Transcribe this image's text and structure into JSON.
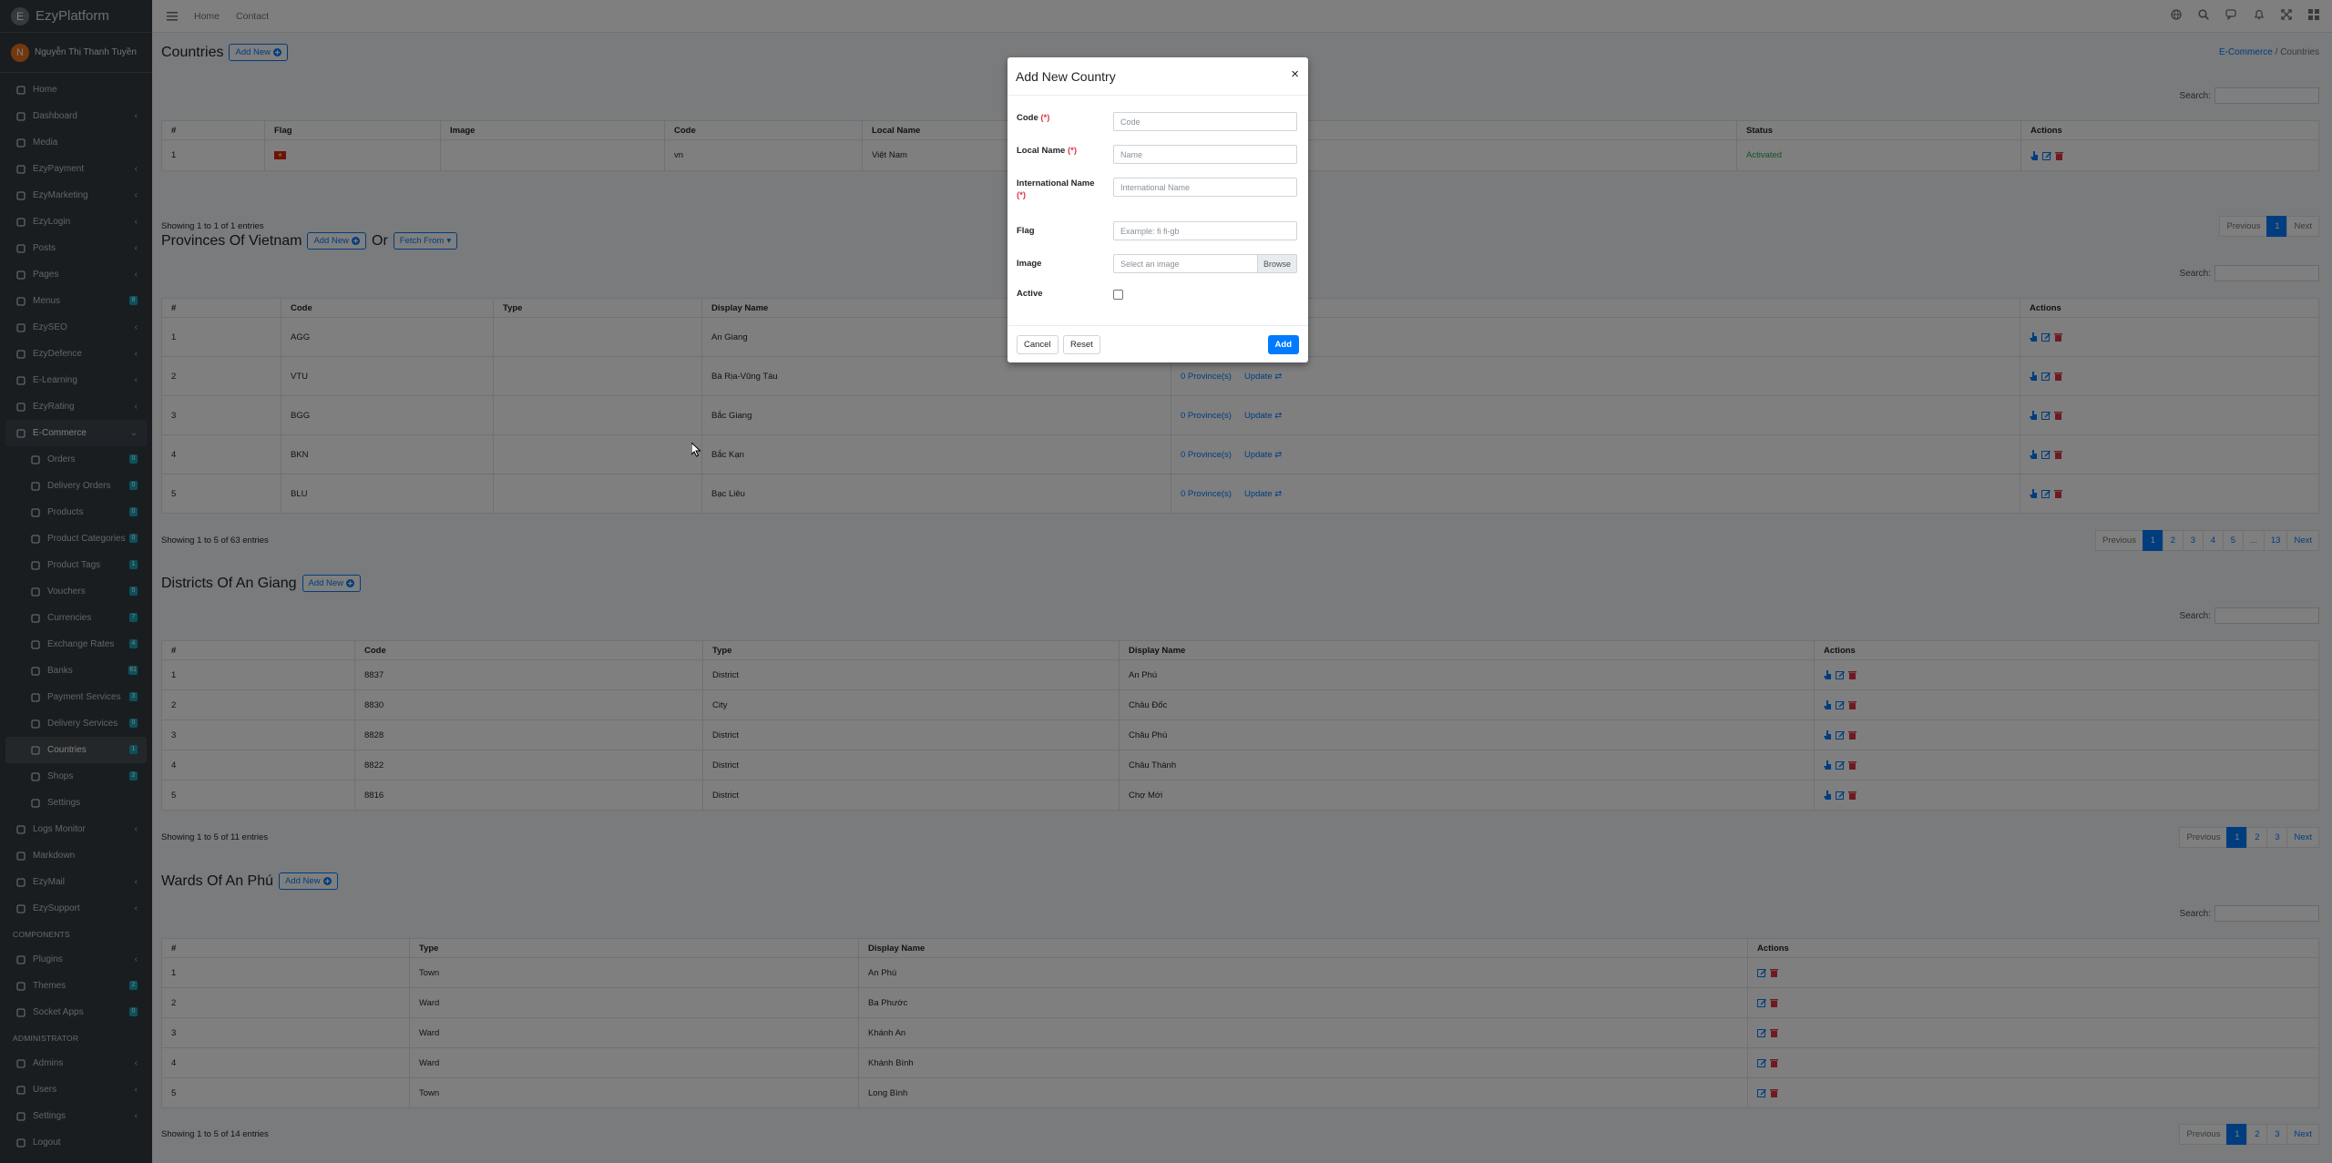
{
  "app": {
    "brand": "EzyPlatform",
    "user_name": "Nguyễn Thị Thanh Tuyền",
    "user_initial": "N"
  },
  "topbar": {
    "links": [
      "Home",
      "Contact"
    ],
    "icons": [
      "globe-icon",
      "search-icon",
      "comments-icon",
      "bell-icon",
      "expand-icon",
      "apps-grid-icon"
    ]
  },
  "sidebar": {
    "items": [
      {
        "label": "Home",
        "icon": "home-icon"
      },
      {
        "label": "Dashboard",
        "icon": "dashboard-icon",
        "arrow": true
      },
      {
        "label": "Media",
        "icon": "media-icon"
      },
      {
        "label": "EzyPayment",
        "icon": "payment-icon",
        "arrow": true
      },
      {
        "label": "EzyMarketing",
        "icon": "bullhorn-icon",
        "arrow": true
      },
      {
        "label": "EzyLogin",
        "icon": "login-icon",
        "arrow": true
      },
      {
        "label": "Posts",
        "icon": "posts-icon",
        "arrow": true
      },
      {
        "label": "Pages",
        "icon": "pages-icon",
        "arrow": true
      },
      {
        "label": "Menus",
        "icon": "menus-icon",
        "badge": "8"
      },
      {
        "label": "EzySEO",
        "icon": "seo-icon",
        "arrow": true
      },
      {
        "label": "EzyDefence",
        "icon": "shield-icon",
        "arrow": true
      },
      {
        "label": "E-Learning",
        "icon": "learning-icon",
        "arrow": true
      },
      {
        "label": "EzyRating",
        "icon": "star-icon",
        "arrow": true
      },
      {
        "label": "E-Commerce",
        "icon": "shop-icon",
        "open": true
      },
      {
        "label": "Orders",
        "icon": "orders-icon",
        "badge": "0",
        "sub": true
      },
      {
        "label": "Delivery Orders",
        "icon": "delivery-icon",
        "badge": "0",
        "sub": true
      },
      {
        "label": "Products",
        "icon": "products-icon",
        "badge": "0",
        "sub": true
      },
      {
        "label": "Product Categories",
        "icon": "categories-icon",
        "badge": "0",
        "sub": true
      },
      {
        "label": "Product Tags",
        "icon": "tags-icon",
        "badge": "1",
        "sub": true
      },
      {
        "label": "Vouchers",
        "icon": "voucher-icon",
        "badge": "0",
        "sub": true
      },
      {
        "label": "Currencies",
        "icon": "currency-icon",
        "badge": "7",
        "sub": true
      },
      {
        "label": "Exchange Rates",
        "icon": "exchange-icon",
        "badge": "4",
        "sub": true
      },
      {
        "label": "Banks",
        "icon": "bank-icon",
        "badge": "61",
        "sub": true
      },
      {
        "label": "Payment Services",
        "icon": "payment-services-icon",
        "badge": "3",
        "sub": true
      },
      {
        "label": "Delivery Services",
        "icon": "truck-icon",
        "badge": "0",
        "sub": true
      },
      {
        "label": "Countries",
        "icon": "globe-icon",
        "badge": "1",
        "sub": true,
        "active": true
      },
      {
        "label": "Shops",
        "icon": "store-icon",
        "badge": "2",
        "sub": true
      },
      {
        "label": "Settings",
        "icon": "tools-icon",
        "sub": true
      },
      {
        "label": "Logs Monitor",
        "icon": "monitor-icon",
        "arrow": true
      },
      {
        "label": "Markdown",
        "icon": "markdown-icon"
      },
      {
        "label": "EzyMail",
        "icon": "mail-icon",
        "arrow": true
      },
      {
        "label": "EzySupport",
        "icon": "support-icon",
        "arrow": true
      }
    ],
    "components_header": "COMPONENTS",
    "components": [
      {
        "label": "Plugins",
        "icon": "plug-icon",
        "arrow": true
      },
      {
        "label": "Themes",
        "icon": "brush-icon",
        "badge": "2"
      },
      {
        "label": "Socket Apps",
        "icon": "socket-icon",
        "badge": "0"
      }
    ],
    "admin_header": "ADMINISTRATOR",
    "admin": [
      {
        "label": "Admins",
        "icon": "user-icon",
        "arrow": true
      },
      {
        "label": "Users",
        "icon": "users-icon",
        "arrow": true
      },
      {
        "label": "Settings",
        "icon": "tools-icon",
        "arrow": true
      },
      {
        "label": "Logout",
        "icon": "logout-icon"
      }
    ]
  },
  "breadcrumb": {
    "parent": "E-Commerce",
    "current": "Countries"
  },
  "countries": {
    "title": "Countries",
    "add_label": "Add New",
    "search_label": "Search:",
    "headers": [
      "#",
      "Flag",
      "Image",
      "Code",
      "Local Name",
      "Status",
      "Actions"
    ],
    "rows": [
      {
        "num": "1",
        "code": "vn",
        "local": "Việt Nam",
        "status": "Activated"
      }
    ],
    "info": "Showing 1 to 1 of 1 entries",
    "pager": [
      "Previous",
      "1",
      "Next"
    ]
  },
  "provinces": {
    "title": "Provinces Of Vietnam",
    "add_label": "Add New",
    "or": "Or",
    "fetch_label": "Fetch From",
    "search_label": "Search:",
    "headers": [
      "#",
      "Code",
      "Type",
      "Display Name",
      "Actions"
    ],
    "rows": [
      {
        "num": "1",
        "code": "AGG",
        "name": "An Giang",
        "sub": "",
        "update": ""
      },
      {
        "num": "2",
        "code": "VTU",
        "name": "Bà Rịa-Vũng Tàu",
        "sub": "0 Province(s)",
        "update": "Update"
      },
      {
        "num": "3",
        "code": "BGG",
        "name": "Bắc Giang",
        "sub": "0 Province(s)",
        "update": "Update"
      },
      {
        "num": "4",
        "code": "BKN",
        "name": "Bắc Kạn",
        "sub": "0 Province(s)",
        "update": "Update"
      },
      {
        "num": "5",
        "code": "BLU",
        "name": "Bạc Liêu",
        "sub": "0 Province(s)",
        "update": "Update"
      }
    ],
    "info": "Showing 1 to 5 of 63 entries",
    "pager": [
      "Previous",
      "1",
      "2",
      "3",
      "4",
      "5",
      "...",
      "13",
      "Next"
    ]
  },
  "districts": {
    "title": "Districts Of An Giang",
    "add_label": "Add New",
    "search_label": "Search:",
    "headers": [
      "#",
      "Code",
      "Type",
      "Display Name",
      "Actions"
    ],
    "rows": [
      {
        "num": "1",
        "code": "8837",
        "type": "District",
        "name": "An Phú"
      },
      {
        "num": "2",
        "code": "8830",
        "type": "City",
        "name": "Châu Đốc"
      },
      {
        "num": "3",
        "code": "8828",
        "type": "District",
        "name": "Châu Phú"
      },
      {
        "num": "4",
        "code": "8822",
        "type": "District",
        "name": "Châu Thành"
      },
      {
        "num": "5",
        "code": "8816",
        "type": "District",
        "name": "Chợ Mới"
      }
    ],
    "info": "Showing 1 to 5 of 11 entries",
    "pager": [
      "Previous",
      "1",
      "2",
      "3",
      "Next"
    ]
  },
  "wards": {
    "title": "Wards Of An Phú",
    "add_label": "Add New",
    "search_label": "Search:",
    "headers": [
      "#",
      "Type",
      "Display Name",
      "Actions"
    ],
    "rows": [
      {
        "num": "1",
        "type": "Town",
        "name": "An Phú"
      },
      {
        "num": "2",
        "type": "Ward",
        "name": "Ba Phước"
      },
      {
        "num": "3",
        "type": "Ward",
        "name": "Khánh An"
      },
      {
        "num": "4",
        "type": "Ward",
        "name": "Khánh Bình"
      },
      {
        "num": "5",
        "type": "Town",
        "name": "Long Bình"
      }
    ],
    "info": "Showing 1 to 5 of 14 entries",
    "pager": [
      "Previous",
      "1",
      "2",
      "3",
      "Next"
    ]
  },
  "modal": {
    "title": "Add New Country",
    "close": "×",
    "code_label": "Code",
    "code_placeholder": "Code",
    "local_label": "Local Name",
    "local_placeholder": "Name",
    "intl_label": "International Name",
    "intl_placeholder": "International Name",
    "flag_label": "Flag",
    "flag_placeholder": "Example: fi fi-gb",
    "image_label": "Image",
    "image_placeholder": "Select an image",
    "browse": "Browse",
    "active_label": "Active",
    "active_checked": false,
    "required_mark": "(*)",
    "cancel": "Cancel",
    "reset": "Reset",
    "add": "Add"
  },
  "colors": {
    "primary": "#007bff",
    "danger": "#dc3545",
    "success": "#28a745",
    "sidebar": "#343a40"
  }
}
